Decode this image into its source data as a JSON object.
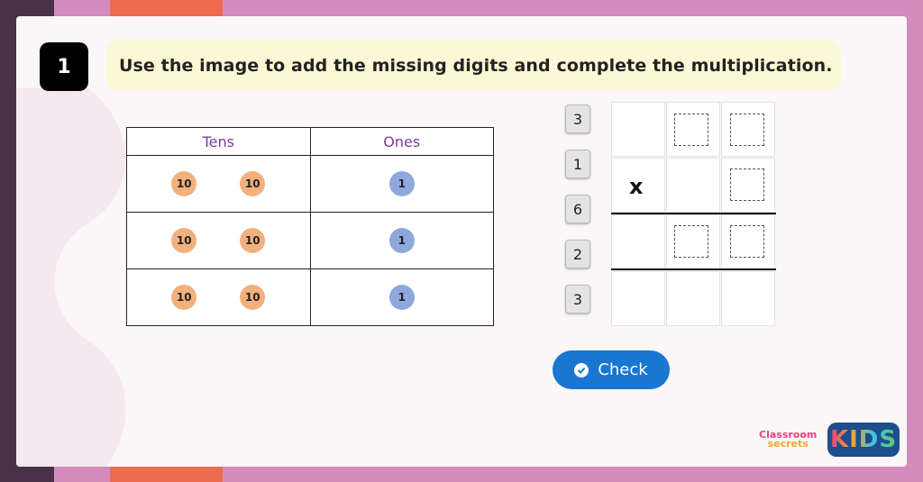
{
  "question": {
    "number": "1",
    "text": "Use the image to add the missing digits and complete the multiplication."
  },
  "place_value_table": {
    "headers": [
      "Tens",
      "Ones"
    ],
    "rows": [
      {
        "tens": [
          "10",
          "10"
        ],
        "ones": [
          "1"
        ]
      },
      {
        "tens": [
          "10",
          "10"
        ],
        "ones": [
          "1"
        ]
      },
      {
        "tens": [
          "10",
          "10"
        ],
        "ones": [
          "1"
        ]
      }
    ],
    "colors": {
      "tens_counter": "#f2b07e",
      "ones_counter": "#8fa8dc",
      "header_text": "#7a3aa0"
    }
  },
  "digit_tiles": [
    "3",
    "1",
    "6",
    "2",
    "3"
  ],
  "multiplication": {
    "operator": "x"
  },
  "check_button": {
    "label": "Check",
    "icon": "check-circle-icon",
    "color": "#1976d2"
  },
  "branding": {
    "line1": "Classroom",
    "line2": "secrets",
    "kids": "KIDS"
  }
}
